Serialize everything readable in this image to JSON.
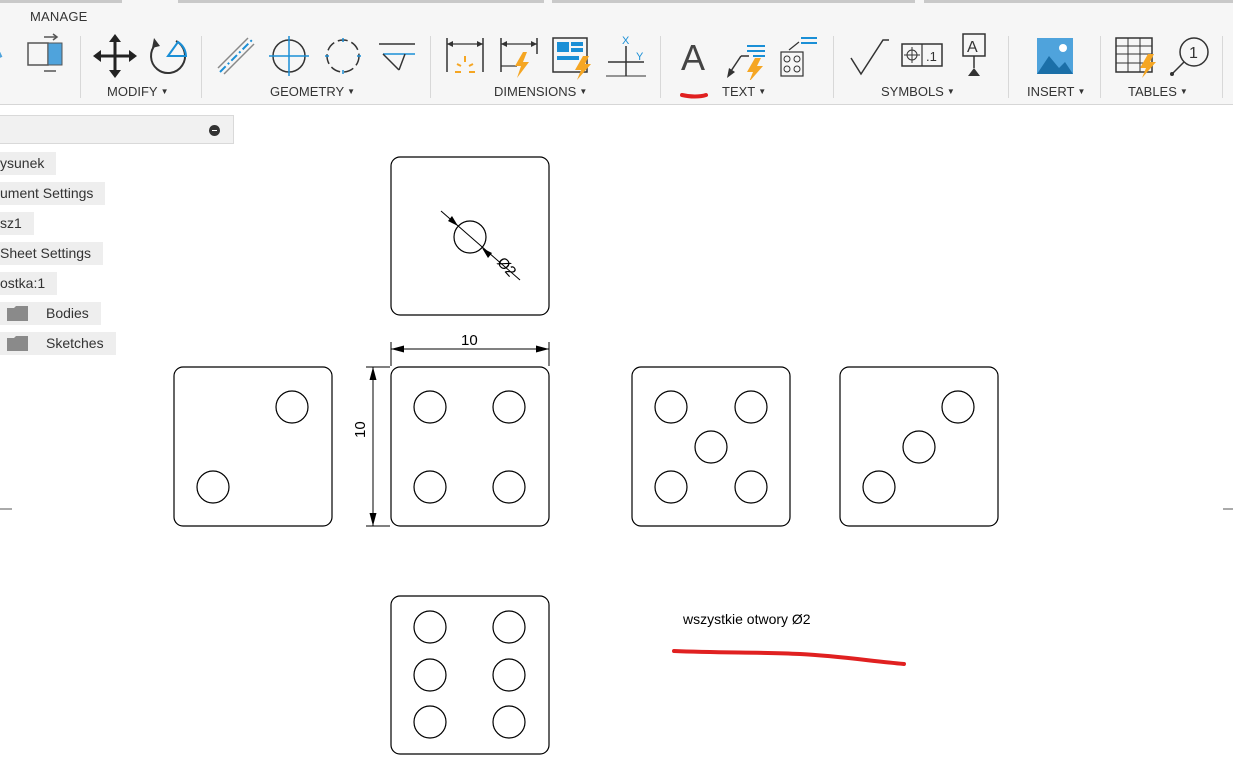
{
  "toolbar": {
    "tab": "MANAGE",
    "groups": {
      "modify": "MODIFY",
      "geometry": "GEOMETRY",
      "dimensions": "DIMENSIONS",
      "text": "TEXT",
      "symbols": "SYMBOLS",
      "insert": "INSERT",
      "tables": "TABLES"
    },
    "icons": [
      "move-icon",
      "rotate-icon",
      "centerline-icon",
      "center-mark-icon",
      "center-mark-pattern-icon",
      "edge-extension-icon",
      "dimension-icon",
      "auto-dimension-icon",
      "baseline-dimension-icon",
      "ordinate-dimension-icon",
      "text-icon",
      "leader-text-icon",
      "note-icon",
      "surface-texture-icon",
      "feature-control-frame-icon",
      "datum-identifier-icon",
      "insert-image-icon",
      "table-icon",
      "balloon-icon"
    ],
    "accent_blue": "#1a8fd6",
    "accent_orange": "#f5a623"
  },
  "browser": {
    "items": [
      "ysunek",
      "ument Settings",
      "sz1",
      "Sheet Settings",
      "ostka:1",
      "Bodies",
      "Sketches"
    ]
  },
  "drawing": {
    "dimensions": {
      "width": "10",
      "height": "10",
      "hole": "Ø2"
    },
    "note": "wszystkie otwory Ø2",
    "annotation_color": "#e02020"
  }
}
